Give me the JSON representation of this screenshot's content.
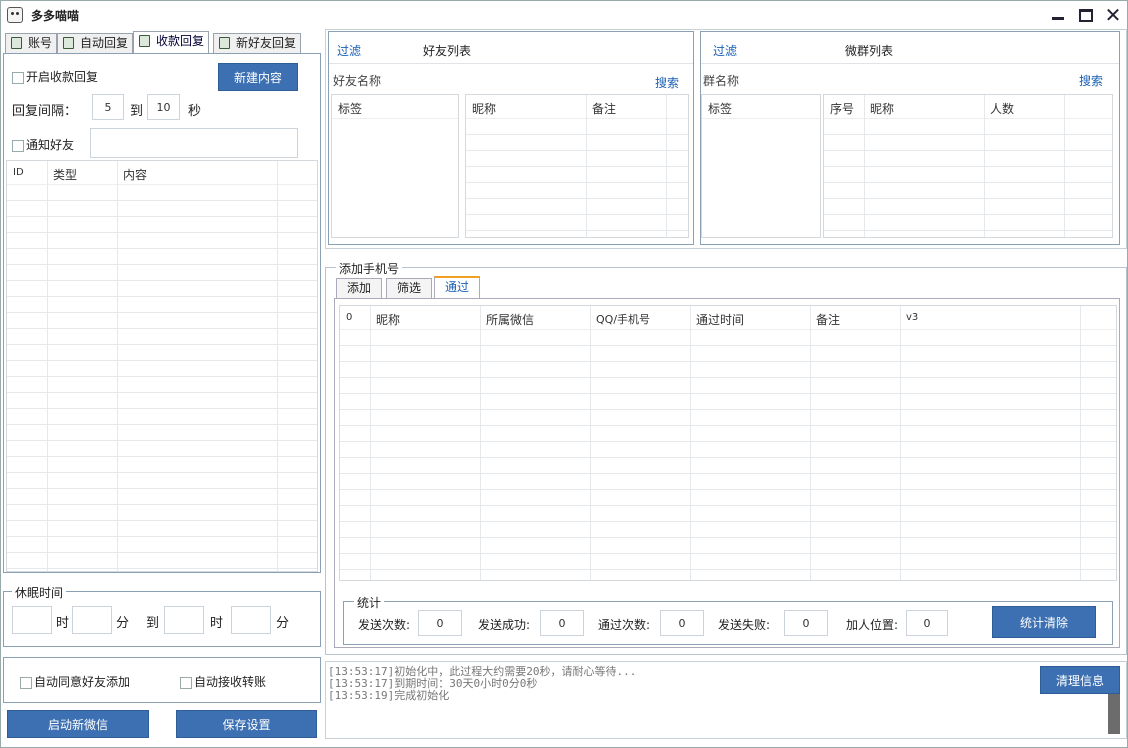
{
  "title": "多多喵喵",
  "tabs": [
    "账号",
    "自动回复",
    "收款回复",
    "新好友回复"
  ],
  "left": {
    "enable_label": "开启收款回复",
    "new_btn": "新建内容",
    "interval_label": "回复间隔：",
    "interval_from": "5",
    "to": "到",
    "interval_to": "10",
    "sec": "秒",
    "notify_label": "通知好友",
    "cols": [
      "ID",
      "类型",
      "内容"
    ]
  },
  "sleep": {
    "title": "休眠时间",
    "hour": "时",
    "minute": "分",
    "to": "到"
  },
  "options": {
    "auto_accept": "自动同意好友添加",
    "auto_transfer": "自动接收转账"
  },
  "bottom": {
    "start": "启动新微信",
    "save": "保存设置"
  },
  "friends": {
    "filter": "过滤",
    "title": "好友列表",
    "name_label": "好友名称",
    "search": "搜索",
    "tag_col": "标签",
    "cols": [
      "昵称",
      "备注"
    ]
  },
  "groups": {
    "filter": "过滤",
    "title": "微群列表",
    "name_label": "群名称",
    "search": "搜索",
    "tag_col": "标签",
    "cols": [
      "序号",
      "昵称",
      "人数"
    ]
  },
  "phone": {
    "title": "添加手机号",
    "tabs": [
      "添加",
      "筛选",
      "通过"
    ],
    "cols": [
      "0",
      "昵称",
      "所属微信",
      "QQ/手机号",
      "通过时间",
      "备注",
      "v3"
    ],
    "stats": {
      "title": "统计",
      "items": [
        {
          "label": "发送次数:",
          "value": "0"
        },
        {
          "label": "发送成功:",
          "value": "0"
        },
        {
          "label": "通过次数:",
          "value": "0"
        },
        {
          "label": "发送失败:",
          "value": "0"
        },
        {
          "label": "加人位置:",
          "value": "0"
        }
      ],
      "clear": "统计清除"
    }
  },
  "log": {
    "lines": [
      "[13:53:17]初始化中，此过程大约需要20秒，请耐心等待...",
      "[13:53:17]到期时间：30天0小时0分0秒",
      "[13:53:19]完成初始化"
    ],
    "clear": "清理信息"
  }
}
